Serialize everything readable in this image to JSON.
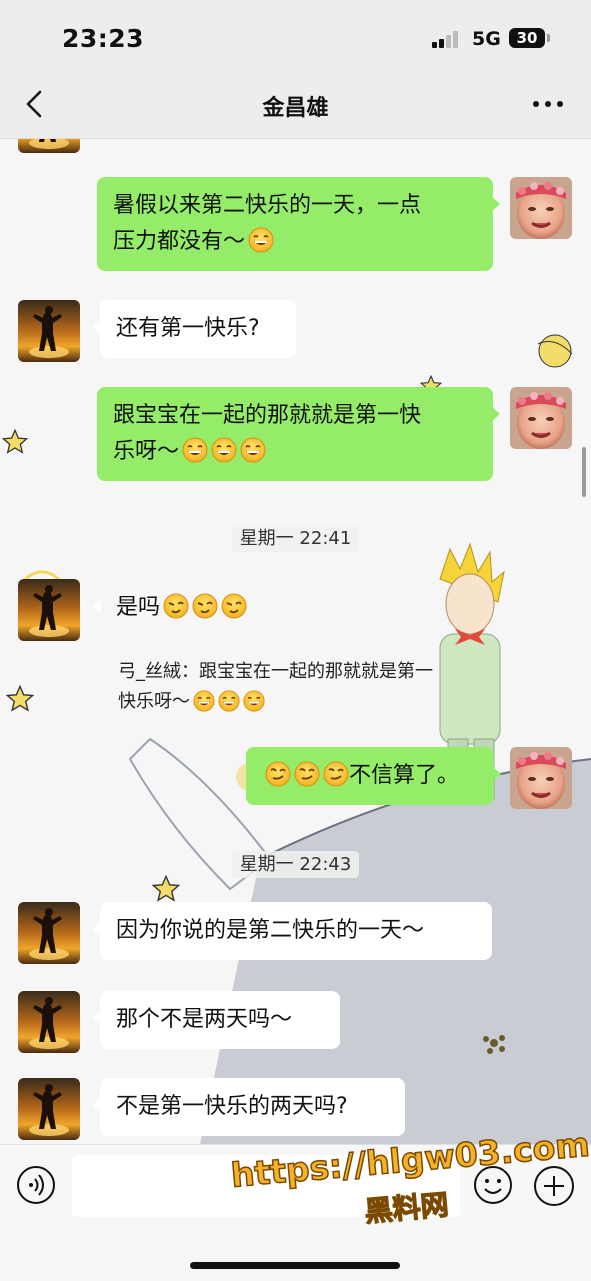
{
  "status_bar": {
    "time": "23:23",
    "network": "5G",
    "battery": "30"
  },
  "header": {
    "title": "金昌雄"
  },
  "messages": [
    {
      "side": "right",
      "text": "暑假以来第二快乐的一天，一点",
      "text2": "压力都没有～"
    },
    {
      "side": "left",
      "text": "还有第一快乐?"
    },
    {
      "side": "right",
      "text": "跟宝宝在一起的那就就是第一快",
      "text2": "乐呀～"
    },
    {
      "timestamp": "星期一 22:41"
    },
    {
      "side": "left",
      "text": "是吗",
      "quote_line1": "弓_丝絨：跟宝宝在一起的那就就是第一",
      "quote_line2": "快乐呀～"
    },
    {
      "side": "right",
      "text": "不信算了。"
    },
    {
      "timestamp": "星期一 22:43"
    },
    {
      "side": "left",
      "text": "因为你说的是第二快乐的一天～"
    },
    {
      "side": "left",
      "text": "那个不是两天吗～"
    },
    {
      "side": "left",
      "text": "不是第一快乐的两天吗?"
    }
  ],
  "input": {
    "placeholder": ""
  },
  "watermark": {
    "url": "https://hlgw03.com",
    "name": "黑料网"
  },
  "icons": [
    "back-icon",
    "more-icon",
    "voice-icon",
    "emoji-icon",
    "plus-icon"
  ],
  "colors": {
    "bubble_sent": "#95ec69",
    "bubble_received": "#ffffff",
    "header_bg": "#ededed"
  }
}
